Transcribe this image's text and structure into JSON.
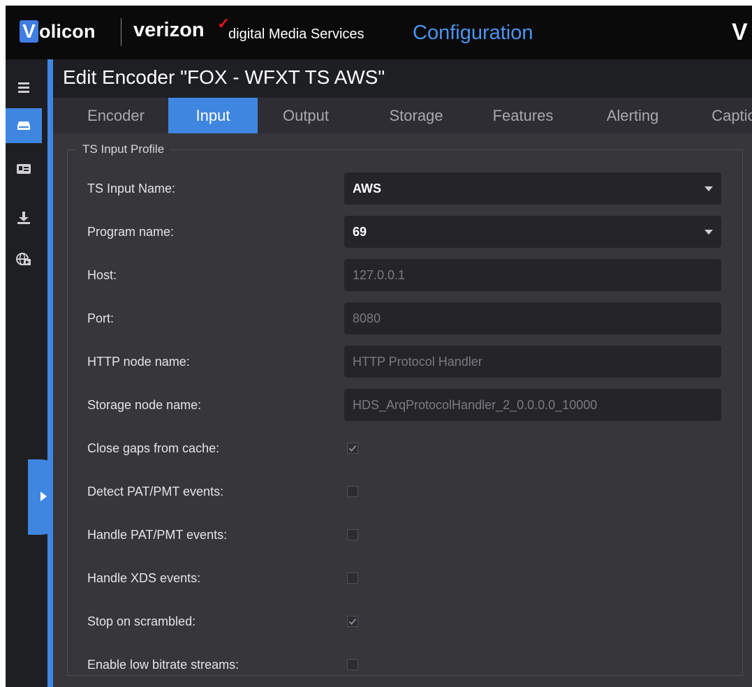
{
  "header": {
    "logo_letter": "V",
    "brand": "olicon",
    "partner": "verizon",
    "check_mark": "✓",
    "subtitle": "digital Media Services",
    "section": "Configuration",
    "right_logo": "V"
  },
  "nav": {
    "items": [
      {
        "icon": "menu-icon",
        "active": false
      },
      {
        "icon": "encoder-icon",
        "active": true
      },
      {
        "icon": "id-card-icon",
        "active": false
      },
      {
        "icon": "download-icon",
        "active": false
      },
      {
        "icon": "globe-video-icon",
        "active": false
      }
    ],
    "expand_icon": "chevron-right-icon"
  },
  "page": {
    "title": "Edit Encoder \"FOX - WFXT TS AWS\""
  },
  "tabs": [
    {
      "label": "Encoder",
      "active": false
    },
    {
      "label": "Input",
      "active": true
    },
    {
      "label": "Output",
      "active": false
    },
    {
      "label": "Storage",
      "active": false
    },
    {
      "label": "Features",
      "active": false
    },
    {
      "label": "Alerting",
      "active": false
    },
    {
      "label": "Captio",
      "active": false
    }
  ],
  "form": {
    "legend": "TS Input Profile",
    "fields": [
      {
        "label": "TS Input Name:",
        "type": "select",
        "value": "AWS"
      },
      {
        "label": "Program name:",
        "type": "select",
        "value": "69"
      },
      {
        "label": "Host:",
        "type": "readonly",
        "value": "127.0.0.1"
      },
      {
        "label": "Port:",
        "type": "readonly",
        "value": "8080"
      },
      {
        "label": "HTTP node name:",
        "type": "readonly",
        "value": "HTTP Protocol Handler"
      },
      {
        "label": "Storage node name:",
        "type": "readonly",
        "value": "HDS_ArqProtocolHandler_2_0.0.0.0_10000"
      }
    ],
    "checkboxes": [
      {
        "label": "Close gaps from cache:",
        "checked": true
      },
      {
        "label": "Detect PAT/PMT events:",
        "checked": false
      },
      {
        "label": "Handle PAT/PMT events:",
        "checked": false
      },
      {
        "label": "Handle XDS events:",
        "checked": false
      },
      {
        "label": "Stop on scrambled:",
        "checked": true
      },
      {
        "label": "Enable low bitrate streams:",
        "checked": false
      }
    ]
  },
  "colors": {
    "accent": "#3f86e1",
    "config_text": "#4b94f0",
    "background": "#36363b",
    "input_bg": "#252529"
  }
}
